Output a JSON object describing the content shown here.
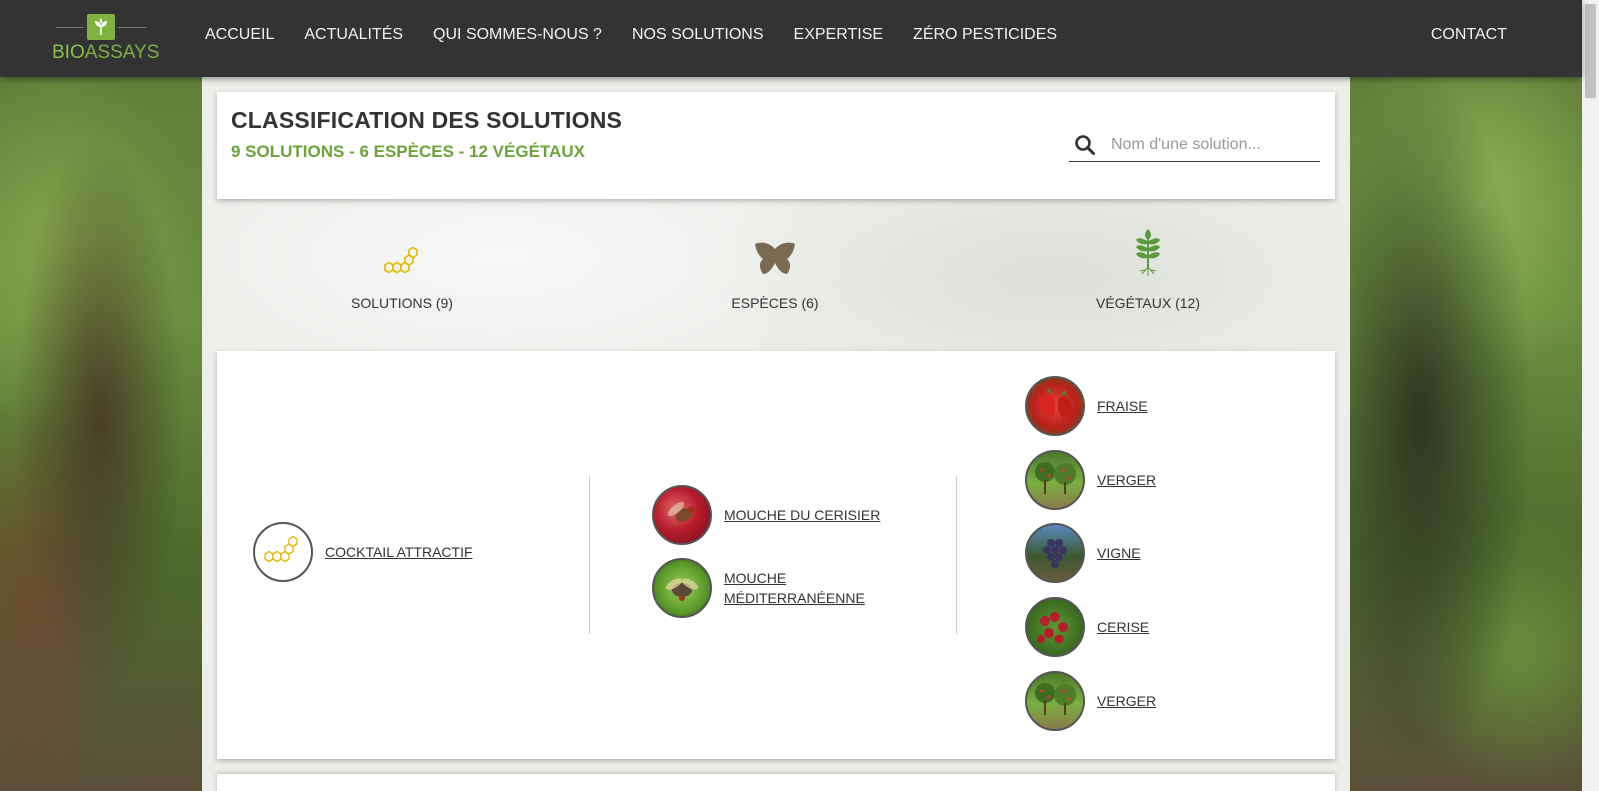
{
  "nav": {
    "logo_text_bio": "BIO",
    "logo_text_assays": "ASSAYS",
    "links": [
      "ACCUEIL",
      "ACTUALITÉS",
      "QUI SOMMES-NOUS ?",
      "NOS SOLUTIONS",
      "EXPERTISE",
      "ZÉRO PESTICIDES"
    ],
    "contact": "CONTACT"
  },
  "header": {
    "title": "CLASSIFICATION DES SOLUTIONS",
    "counts": "9 SOLUTIONS - 6 ESPÈCES - 12 VÉGÉTAUX",
    "search_placeholder": "Nom d'une solution..."
  },
  "categories": [
    {
      "label": "SOLUTIONS (9)",
      "icon": "honeycomb-icon",
      "color": "#e6b800"
    },
    {
      "label": "ESPÈCES (6)",
      "icon": "butterfly-icon",
      "color": "#7a6a52"
    },
    {
      "label": "VÉGÉTAUX (12)",
      "icon": "plant-icon",
      "color": "#5b9a3a"
    }
  ],
  "results": {
    "solutions": [
      {
        "label": "COCKTAIL ATTRACTIF",
        "icon": "honeycomb-icon"
      }
    ],
    "especes": [
      {
        "label": "MOUCHE DU CERISIER",
        "icon": "cherry-fly-photo"
      },
      {
        "label": "MOUCHE MÉDITERRANÉENNE",
        "icon": "med-fly-photo"
      }
    ],
    "vegetaux": [
      {
        "label": "FRAISE",
        "icon": "strawberry-photo"
      },
      {
        "label": "VERGER",
        "icon": "orchard-photo"
      },
      {
        "label": "VIGNE",
        "icon": "grape-photo"
      },
      {
        "label": "CERISE",
        "icon": "cherry-photo"
      },
      {
        "label": "VERGER",
        "icon": "orchard-photo"
      }
    ]
  },
  "colors": {
    "navbar": "#333333",
    "brand_green": "#6da33a",
    "accent_yellow": "#e6b800"
  }
}
